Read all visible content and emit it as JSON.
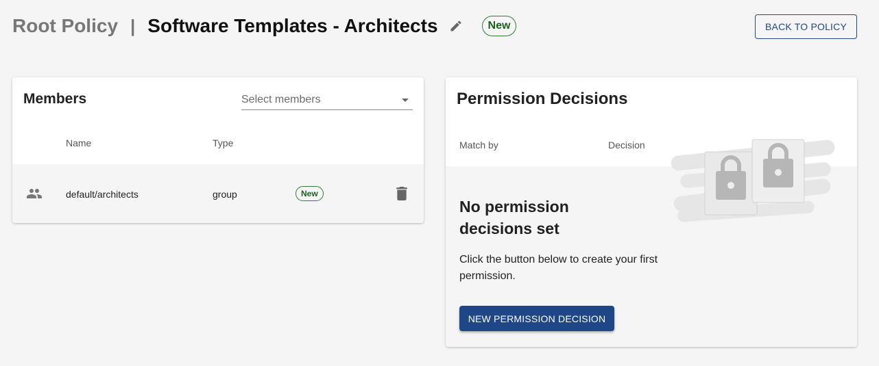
{
  "header": {
    "root_policy": "Root Policy",
    "separator": "|",
    "title": "Software Templates - Architects",
    "new_chip": "New",
    "back_button": "BACK TO POLICY"
  },
  "members": {
    "title": "Members",
    "select_placeholder": "Select members",
    "columns": {
      "name": "Name",
      "type": "Type"
    },
    "rows": [
      {
        "name": "default/architects",
        "type": "group",
        "chip": "New",
        "icon": "group-icon"
      }
    ]
  },
  "permissions": {
    "title": "Permission Decisions",
    "columns": {
      "match_by": "Match by",
      "decision": "Decision"
    },
    "empty_title": "No permission decisions set",
    "empty_description": "Click the button below to create your first permission.",
    "new_button": "NEW PERMISSION DECISION"
  },
  "colors": {
    "primary": "#1f4788",
    "success": "#2e7d32",
    "background": "#f5f5f5"
  },
  "icons": [
    "edit-icon",
    "group-icon",
    "delete-icon",
    "lock-icon"
  ]
}
